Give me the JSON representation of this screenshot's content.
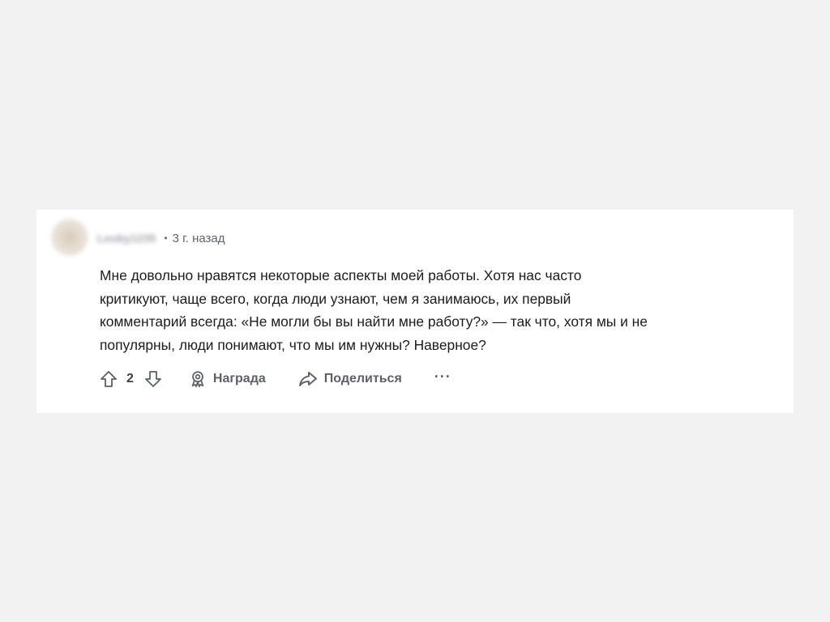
{
  "comment": {
    "author": "Leuby1235",
    "separator": "•",
    "timestamp": "3 г. назад",
    "body": "Мне довольно нравятся некоторые аспекты моей работы. Хотя нас часто\nкритикуют, чаще всего, когда люди узнают, чем я занимаюсь, их первый\nкомментарий всегда: «Не могли бы вы найти мне работу?» — так что, хотя мы и не\nпопулярны, люди понимают, что мы им нужны? Наверное?"
  },
  "actions": {
    "score": "2",
    "upvote_icon": "upvote-arrow-icon",
    "downvote_icon": "downvote-arrow-icon",
    "award_icon": "award-ribbon-icon",
    "award_label": "Награда",
    "share_icon": "share-arrow-icon",
    "share_label": "Поделиться",
    "more_label": "···"
  },
  "colors": {
    "page_background": "#f2f2f2",
    "card_background": "#ffffff",
    "body_text": "#1c1c1c",
    "muted_text": "#5b6169"
  }
}
